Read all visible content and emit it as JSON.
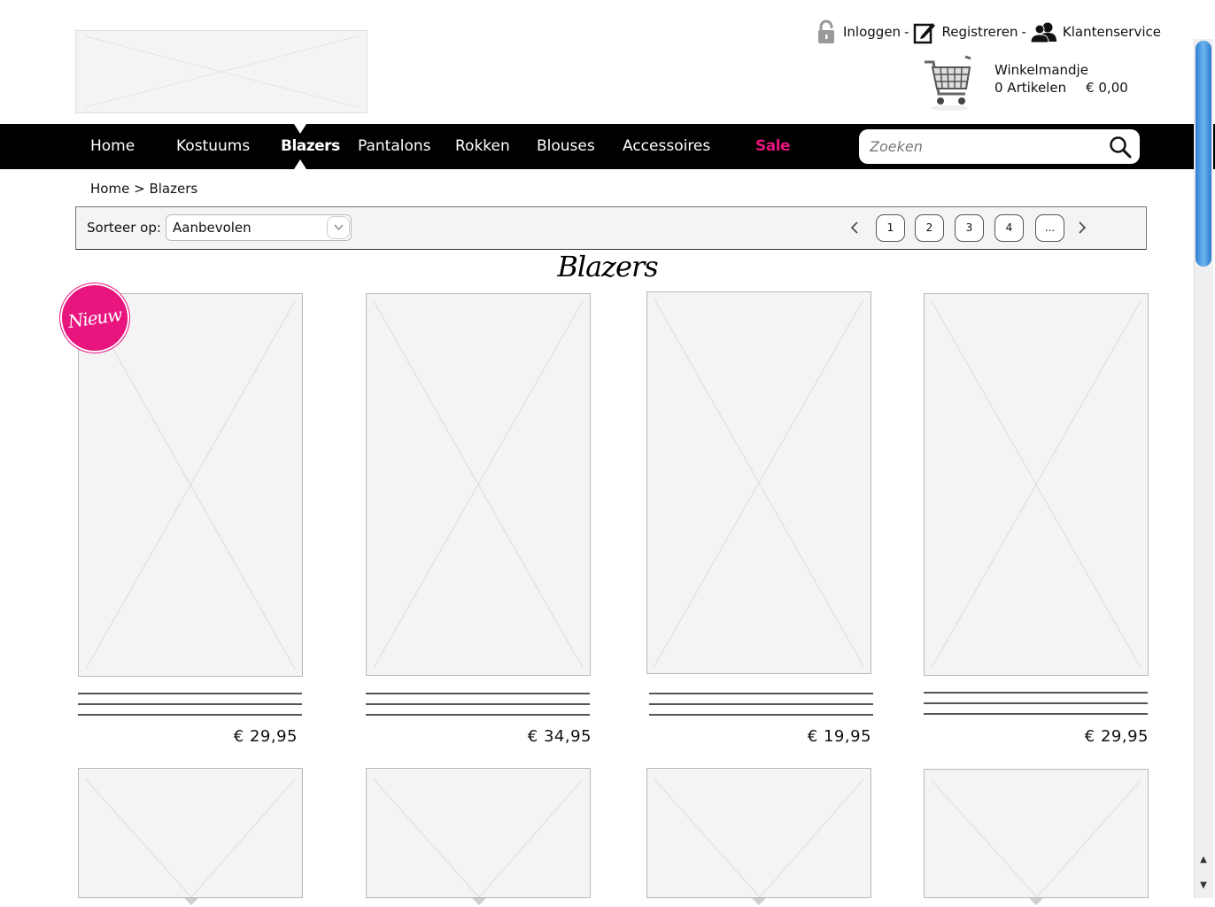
{
  "header": {
    "links": [
      {
        "label": "Inloggen",
        "icon": "lock-icon"
      },
      {
        "label": "Registreren",
        "icon": "edit-icon"
      },
      {
        "label": "Klantenservice",
        "icon": "users-icon"
      }
    ],
    "separator": "-",
    "cart": {
      "title": "Winkelmandje",
      "count": "0 Artikelen",
      "total": "€ 0,00",
      "icon": "shopping-cart-icon"
    }
  },
  "nav": {
    "items": [
      "Home",
      "Kostuums",
      "Blazers",
      "Pantalons",
      "Rokken",
      "Blouses",
      "Accessoires",
      "Sale"
    ],
    "active": "Blazers",
    "sale_color": "#e8157f",
    "search_placeholder": "Zoeken"
  },
  "breadcrumb": {
    "home": "Home",
    "separator": ">",
    "current": "Blazers"
  },
  "toolbar": {
    "sort_label": "Sorteer op:",
    "sort_value": "Aanbevolen",
    "pages": [
      "1",
      "2",
      "3",
      "4",
      "..."
    ]
  },
  "page_title": "Blazers",
  "badge": "Nieuw",
  "products": [
    {
      "price": "€ 29,95"
    },
    {
      "price": "€ 34,95"
    },
    {
      "price": "€ 19,95"
    },
    {
      "price": "€ 29,95"
    }
  ]
}
